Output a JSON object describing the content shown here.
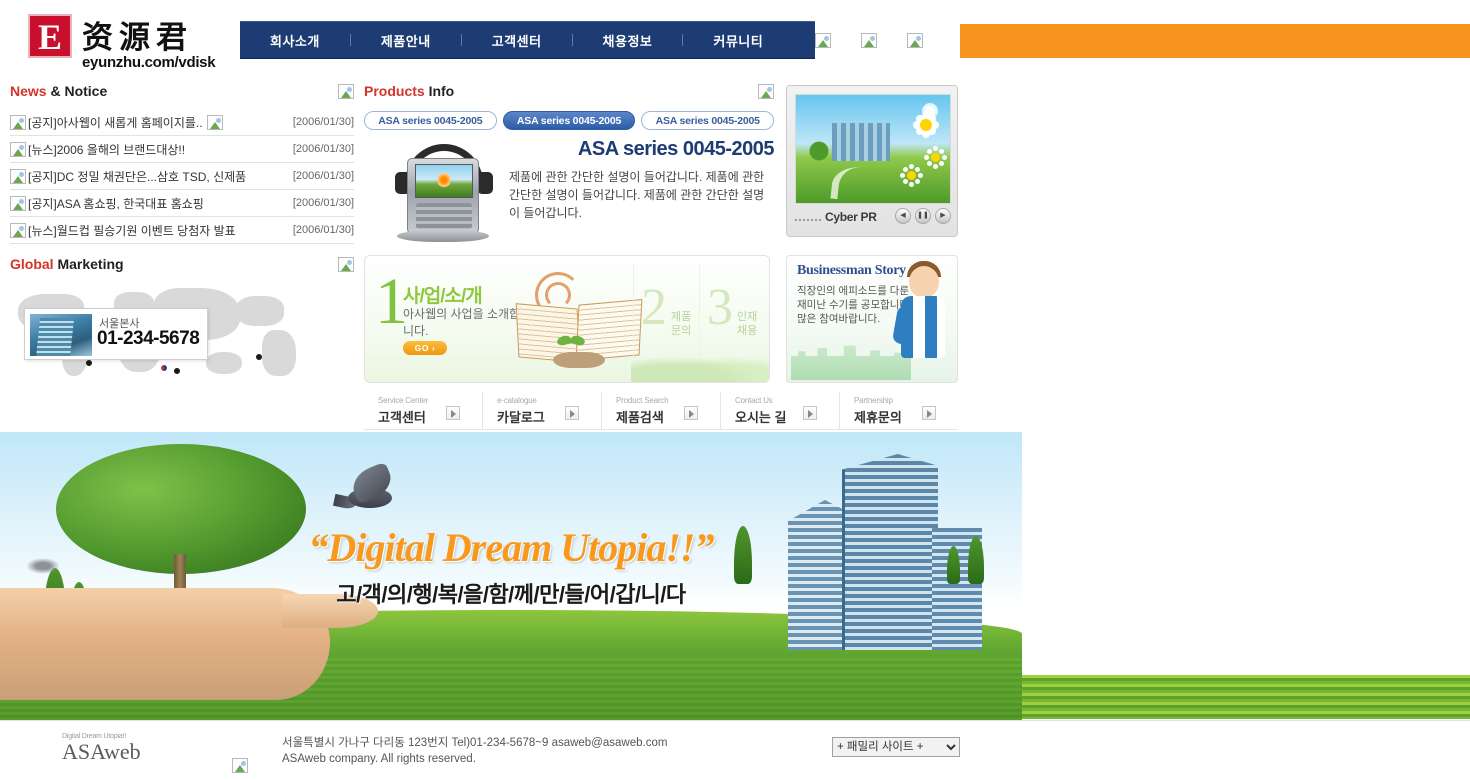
{
  "header": {
    "logo": {
      "mark_letter": "E",
      "cn_name": "资源君",
      "url": "eyunzhu.com/vdisk"
    },
    "nav": [
      {
        "label": "회사소개"
      },
      {
        "label": "제품안내"
      },
      {
        "label": "고객센터"
      },
      {
        "label": "채용정보"
      },
      {
        "label": "커뮤니티"
      }
    ],
    "icons": [
      "broken-image-icon",
      "broken-image-icon",
      "broken-image-icon"
    ],
    "accent_color": "#f7941d",
    "nav_color": "#1d3c74"
  },
  "news": {
    "title_red": "News",
    "title_rest": " & Notice",
    "more_icon": "broken-image-icon",
    "items": [
      {
        "title": "[공지]아사웹이 새롭게 홈페이지를..",
        "date": "[2006/01/30]",
        "has_new_icon": true
      },
      {
        "title": "[뉴스]2006 올해의 브랜드대상!!",
        "date": "[2006/01/30]",
        "has_new_icon": false
      },
      {
        "title": "[공지]DC 정밀 채권단은...삼호 TSD, 신제품",
        "date": "[2006/01/30]",
        "has_new_icon": false
      },
      {
        "title": "[공지]ASA 홈쇼핑, 한국대표 홈쇼핑",
        "date": "[2006/01/30]",
        "has_new_icon": false
      },
      {
        "title": "[뉴스]월드컵 필승기원 이벤트 당첨자 발표",
        "date": "[2006/01/30]",
        "has_new_icon": false
      }
    ]
  },
  "global_marketing": {
    "title_red": "Global",
    "title_rest": " Marketing",
    "more_icon": "broken-image-icon",
    "tooltip": {
      "label": "서울본사",
      "phone": "01-234-5678"
    }
  },
  "products": {
    "title_red": "Products",
    "title_rest": " Info",
    "more_icon": "broken-image-icon",
    "tabs": [
      {
        "label": "ASA series 0045-2005",
        "active": false
      },
      {
        "label": "ASA series 0045-2005",
        "active": true
      },
      {
        "label": "ASA series 0045-2005",
        "active": false
      }
    ],
    "detail_title": "ASA series 0045-2005",
    "detail_desc": "제품에 관한 간단한 설명이 들어갑니다. 제품에 관한 간단한 설명이 들어갑니다. 제품에 관한 간단한 설명이 들어갑니다."
  },
  "cyber_pr": {
    "label": "Cyber PR",
    "controls": [
      {
        "name": "prev-button",
        "glyph": "◀"
      },
      {
        "name": "pause-button",
        "glyph": "❚❚"
      },
      {
        "name": "next-button",
        "glyph": "▶"
      }
    ]
  },
  "promo": {
    "num1": "1",
    "title1": "사/업/소/개",
    "sub1": "아사웹의 사업을 소개합니다.",
    "go_label": "GO ›",
    "num2": "2",
    "label2": "제품 문의",
    "num3": "3",
    "label3": "인재 채용"
  },
  "businessman_story": {
    "title": "Businessman Story",
    "text": "직장인의 에피소드를 다룬 재미난 수기를 공모합니다. 많은 참여바랍니다."
  },
  "quick_links": [
    {
      "en": "Service Center",
      "kr": "고객센터"
    },
    {
      "en": "e-catalogue",
      "kr": "카달로그"
    },
    {
      "en": "Product Search",
      "kr": "제품검색"
    },
    {
      "en": "Contact Us",
      "kr": "오시는 길"
    },
    {
      "en": "Partnership",
      "kr": "제휴문의"
    }
  ],
  "hero": {
    "headline_en": "“Digital Dream Utopia!!”",
    "headline_kr": "고/객/의/행/복/을/함/께/만/들/어/갑/니/다"
  },
  "footer": {
    "logo_tagline": "Digital Dream Utopia!!",
    "logo_name": "ASAweb",
    "icon": "broken-image-icon",
    "address_line1": "서울특별시 가나구 다리동 123번지  Tel)01-234-5678~9  asaweb@asaweb.com",
    "address_line2": "ASAweb company. All rights reserved.",
    "family_site_selected": "+ 패밀리 사이트 +"
  }
}
